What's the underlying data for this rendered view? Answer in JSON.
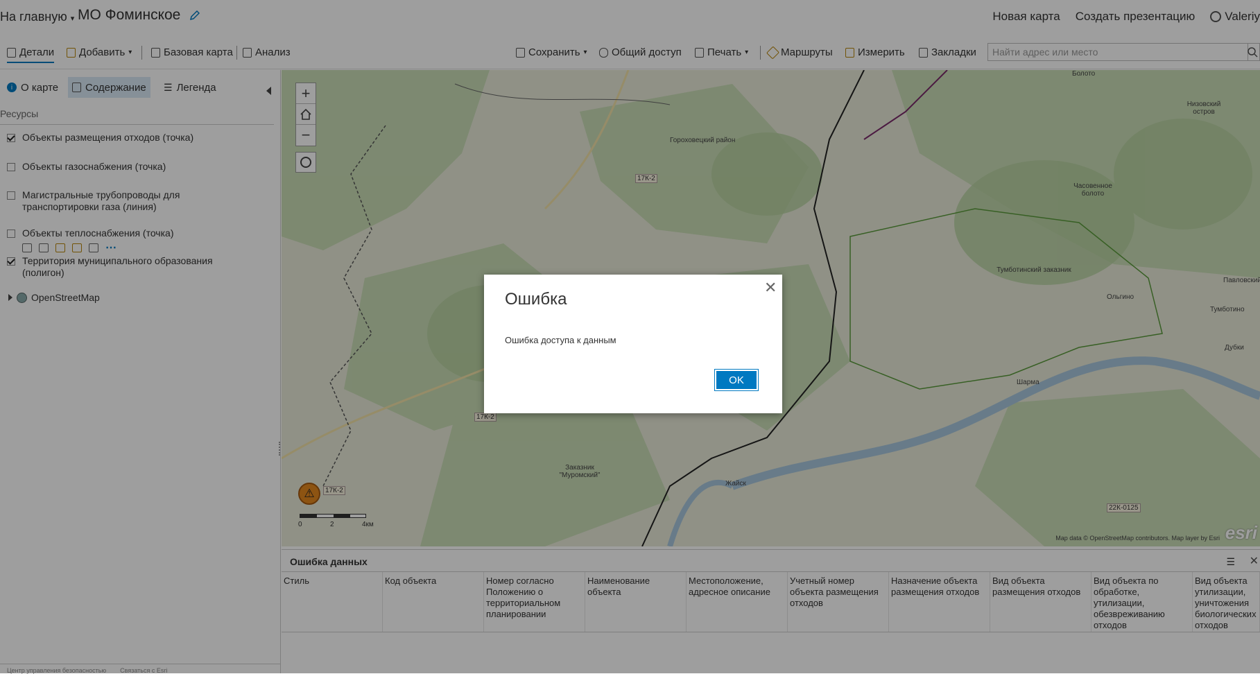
{
  "header": {
    "home_label": "На главную",
    "map_title": "МО Фоминское",
    "new_map": "Новая карта",
    "create_presentation": "Создать презентацию",
    "user": "Valeriy"
  },
  "toolbar": {
    "details": "Детали",
    "add": "Добавить",
    "basemap": "Базовая карта",
    "analysis": "Анализ",
    "save": "Сохранить",
    "share": "Общий доступ",
    "print": "Печать",
    "routes": "Маршруты",
    "measure": "Измерить",
    "bookmarks": "Закладки",
    "search_placeholder": "Найти адрес или место"
  },
  "sidepanel": {
    "tabs": [
      "О карте",
      "Содержание",
      "Легенда"
    ],
    "resources_header": "Ресурсы",
    "layers": [
      {
        "label": "Объекты размещения отходов (точка)",
        "checked": true
      },
      {
        "label": "Объекты газоснабжения (точка)",
        "checked": false
      },
      {
        "label": "Магистральные трубопроводы для транспортировки газа (линия)",
        "checked": false
      },
      {
        "label": "Объекты теплоснабжения (точка)",
        "checked": false
      },
      {
        "label": "Территория муниципального образования (полигон)",
        "checked": true
      }
    ],
    "basemap_layer": "OpenStreetMap",
    "footer_links": [
      "Центр управления безопасностью",
      "Связаться с Esri"
    ]
  },
  "map": {
    "labels": [
      "Гороховецкий район",
      "Тумботинский заказник",
      "Заказник \"Муромский\"",
      "Низовский остров",
      "Тумботино",
      "Шарма",
      "Жайск",
      "Дубки",
      "Павловский",
      "Часовенное болото",
      "Ольгино",
      "Болото"
    ],
    "roads": [
      "17К-2",
      "17К-2",
      "17К-2",
      "22К-0125"
    ],
    "scale_labels": [
      "0",
      "2",
      "4км"
    ],
    "attribution": "Map data © OpenStreetMap contributors. Map layer by Esri",
    "esri_logo": "esri"
  },
  "table": {
    "title": "Ошибка данных",
    "columns": [
      "Стиль",
      "Код объекта",
      "Номер согласно Положению о территориальном планировании",
      "Наименование объекта",
      "Местоположение, адресное описание",
      "Учетный номер объекта размещения отходов",
      "Назначение объекта размещения отходов",
      "Вид объекта размещения отходов",
      "Вид объекта по обработке, утилизации, обезвреживанию отходов",
      "Вид объекта утилизации, уничтожения биологических отходов"
    ]
  },
  "dialog": {
    "title": "Ошибка",
    "message": "Ошибка доступа к данным",
    "ok_label": "OK"
  }
}
